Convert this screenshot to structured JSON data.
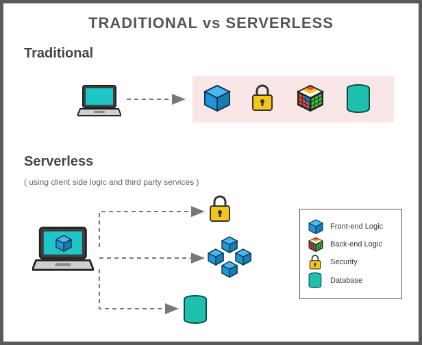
{
  "title": "TRADITIONAL vs SERVERLESS",
  "sections": {
    "traditional": {
      "label": "Traditional"
    },
    "serverless": {
      "label": "Serverless",
      "subnote": "( using client side logic and third party services )"
    }
  },
  "legend": {
    "items": [
      {
        "key": "frontend",
        "label": "Front-end Logic"
      },
      {
        "key": "backend",
        "label": "Back-end Logic"
      },
      {
        "key": "security",
        "label": "Security"
      },
      {
        "key": "database",
        "label": "Database"
      }
    ]
  },
  "icons": {
    "laptop": "laptop",
    "cube": "cube",
    "lock": "lock",
    "rubik": "rubik",
    "database": "database",
    "arrow": "arrow"
  },
  "diagram": {
    "traditional": {
      "source": "laptop",
      "targets": [
        "frontend",
        "security",
        "backend",
        "database"
      ]
    },
    "serverless": {
      "source": "laptop-with-frontend",
      "targets": [
        "security",
        "frontend-cluster",
        "database"
      ]
    }
  }
}
